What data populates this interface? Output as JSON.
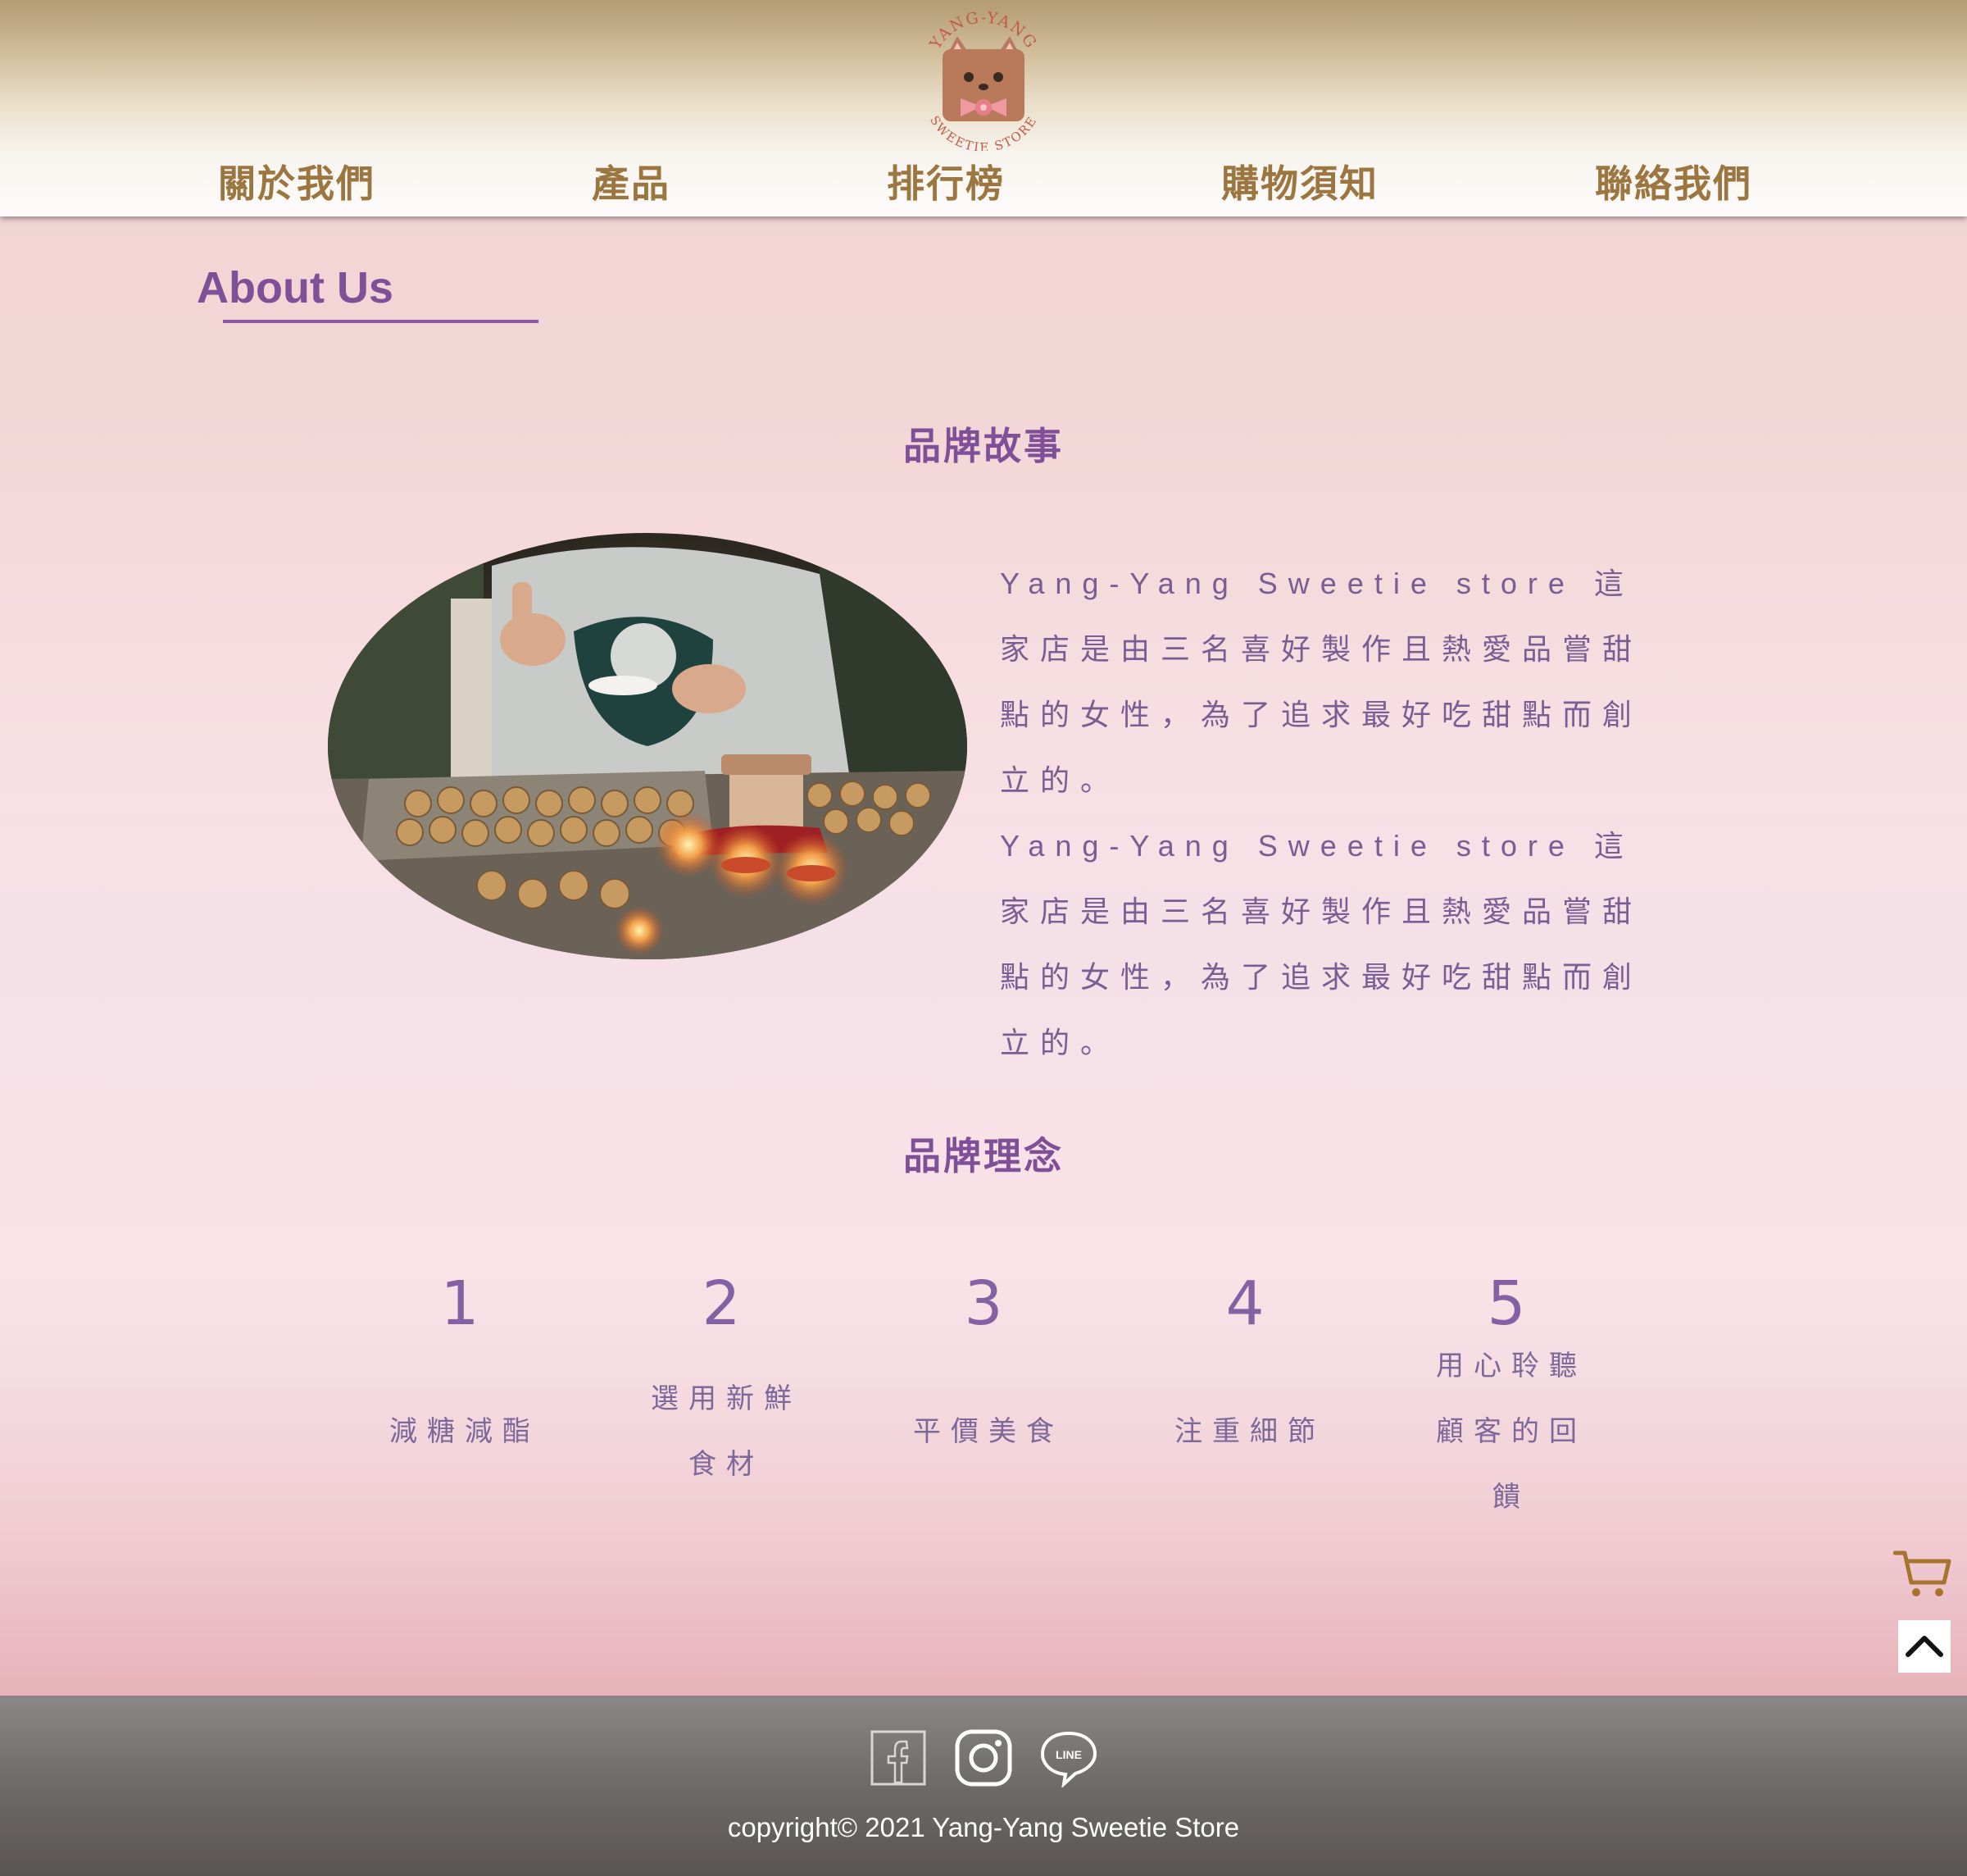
{
  "brand": {
    "logo_top_text": "YANG-YANG",
    "logo_bottom_text": "SWEETIE STORE"
  },
  "nav": {
    "items": [
      {
        "label": "關於我們"
      },
      {
        "label": "產品"
      },
      {
        "label": "排行榜"
      },
      {
        "label": "購物須知"
      },
      {
        "label": "聯絡我們"
      }
    ]
  },
  "about": {
    "title": "About Us"
  },
  "story": {
    "heading": "品牌故事",
    "paragraphs": [
      "Yang-Yang Sweetie store 這家店是由三名喜好製作且熱愛品嘗甜點的女性，為了追求最好吃甜點而創立的。",
      "Yang-Yang Sweetie store 這家店是由三名喜好製作且熱愛品嘗甜點的女性，為了追求最好吃甜點而創立的。"
    ]
  },
  "philosophy": {
    "heading": "品牌理念",
    "items": [
      {
        "number": "1",
        "label": "減糖減酯"
      },
      {
        "number": "2",
        "label": "選用新鮮食材"
      },
      {
        "number": "3",
        "label": "平價美食"
      },
      {
        "number": "4",
        "label": "注重細節"
      },
      {
        "number": "5",
        "label": "用心聆聽顧客的回饋"
      }
    ]
  },
  "footer": {
    "line_icon_text": "LINE",
    "copyright": "copyright© 2021 Yang-Yang Sweetie Store"
  },
  "colors": {
    "nav_text": "#9b7640",
    "heading_purple": "#7f4f97",
    "body_text": "#7a5d92",
    "cart_icon": "#a8732e"
  },
  "icons": [
    "logo-cat-icon",
    "cart-icon",
    "chevron-up-icon",
    "facebook-icon",
    "instagram-icon",
    "line-icon"
  ]
}
